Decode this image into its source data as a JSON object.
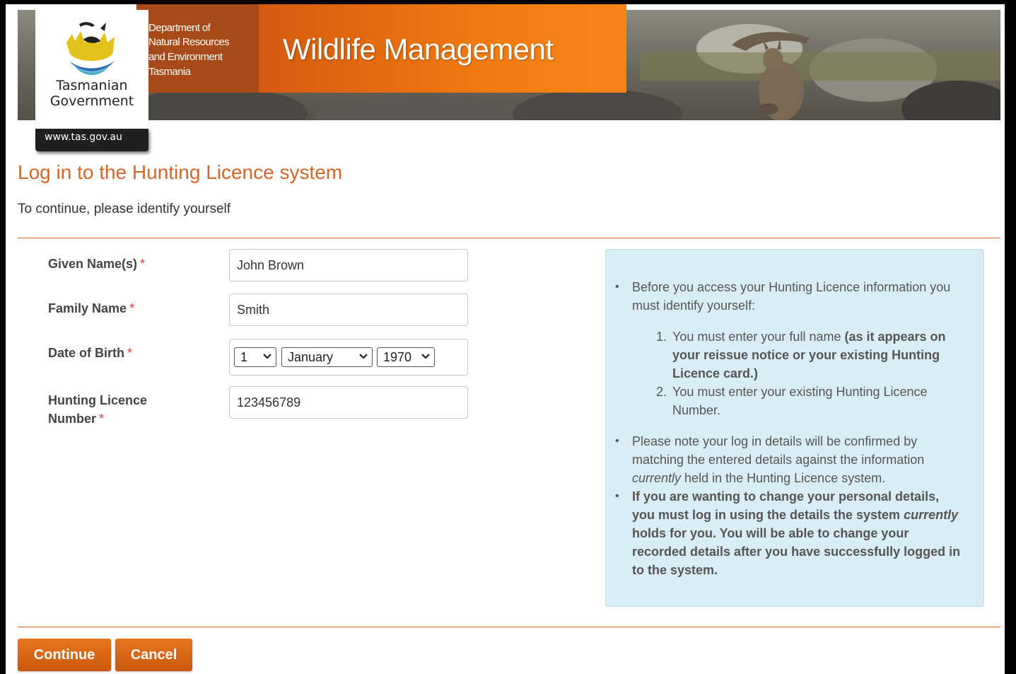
{
  "header": {
    "department_lines": [
      "Department of",
      "Natural Resources",
      "and Environment",
      "Tasmania"
    ],
    "app_title": "Wildlife Management",
    "gov_name_line1": "Tasmanian",
    "gov_name_line2": "Government",
    "gov_url": "www.tas.gov.au"
  },
  "page": {
    "title": "Log in to the Hunting Licence system",
    "intro": "To continue, please identify yourself"
  },
  "form": {
    "given_name": {
      "label": "Given Name(s)",
      "required_mark": "*",
      "value": "John Brown"
    },
    "family_name": {
      "label": "Family Name",
      "required_mark": "*",
      "value": "Smith"
    },
    "dob": {
      "label": "Date of Birth",
      "required_mark": "*",
      "day": "1",
      "month": "January",
      "year": "1970"
    },
    "licence": {
      "label_line1": "Hunting Licence",
      "label_line2": "Number",
      "required_mark": "*",
      "value": "123456789"
    }
  },
  "info": {
    "b1_l1": "Before you access your Hunting Licence information you",
    "b1_l2": "must identify yourself:",
    "n1_mark": "1.",
    "n1_l1_plain": "You must enter your full name",
    "n1_l1_bold": "(as it appears on",
    "n1_l2": "your reissue notice or your existing Hunting",
    "n1_l3": "Licence card.)",
    "n2_mark": "2.",
    "n2_l1": "You must enter your existing Hunting Licence",
    "n2_l2": "Number.",
    "b2_l1": "Please note your log in details will be confirmed by",
    "b2_l2": "matching the entered details against the information",
    "b2_l3_italic": "currently",
    "b2_l3_rest": "held in the Hunting Licence system.",
    "b3_l1": "If you are wanting to change your personal details,",
    "b3_l2_plain": "you must log in using the details the system",
    "b3_l2_italic": "currently",
    "b3_l3": "holds for you. You will be able to change your",
    "b3_l4": "recorded details after you have successfully logged in",
    "b3_l5": "to the system."
  },
  "buttons": {
    "continue": "Continue",
    "cancel": "Cancel"
  },
  "colors": {
    "accent": "#d4662a",
    "button": "#d8660f",
    "info_bg": "#d9edf7",
    "required": "#e0393e"
  }
}
